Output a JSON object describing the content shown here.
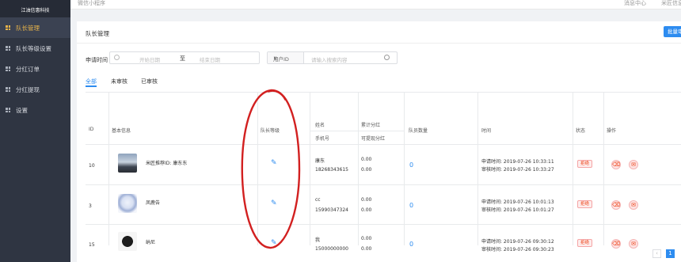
{
  "brand": "江油信惠科技",
  "sidebar": {
    "items": [
      {
        "label": "队长管理",
        "active": true
      },
      {
        "label": "队长等级设置",
        "active": false
      },
      {
        "label": "分红订单",
        "active": false
      },
      {
        "label": "分红提现",
        "active": false
      },
      {
        "label": "设置",
        "active": false
      }
    ]
  },
  "topbar": {
    "app": "微信小程序",
    "messages": "消息中心",
    "user": "米匠信息"
  },
  "page": {
    "title": "队长管理",
    "batch_button": "批量审核"
  },
  "filters": {
    "date_label": "申请时间",
    "start_placeholder": "开始日期",
    "range_sep": "至",
    "end_placeholder": "结束日期",
    "select_value": "用户ID",
    "search_placeholder": "请输入搜索内容"
  },
  "tabs": [
    {
      "label": "全部",
      "active": true
    },
    {
      "label": "未审核",
      "active": false
    },
    {
      "label": "已审核",
      "active": false
    }
  ],
  "table": {
    "headers": {
      "id": "ID",
      "basic": "基本信息",
      "level": "队长等级",
      "name": "姓名",
      "phone": "手机号",
      "total": "累计分红",
      "withdrawable": "可提现分红",
      "members": "队员数量",
      "time": "时间",
      "status": "状态",
      "action": "操作"
    },
    "rows": [
      {
        "id": "10",
        "nickname": "米匠推荐ID: 康东东",
        "name": "康东",
        "phone": "18268343615",
        "total": "0.00",
        "withdrawable": "0.00",
        "members": "0",
        "apply_time": "申请时间: 2019-07-26 10:33:11",
        "review_time": "审核时间: 2019-07-26 10:33:27",
        "status": "拒绝"
      },
      {
        "id": "3",
        "nickname": "凤鹿告",
        "name": "cc",
        "phone": "15990347324",
        "total": "0.00",
        "withdrawable": "0.00",
        "members": "0",
        "apply_time": "申请时间: 2019-07-26 10:01:13",
        "review_time": "审核时间: 2019-07-26 10:01:27",
        "status": "拒绝"
      },
      {
        "id": "15",
        "nickname": "纳尼",
        "name": "我",
        "phone": "15000000000",
        "total": "0.00",
        "withdrawable": "0.00",
        "members": "0",
        "apply_time": "申请时间: 2019-07-26 09:30:12",
        "review_time": "审核时间: 2019-07-26 09:30:23",
        "status": "拒绝"
      }
    ]
  },
  "pagination": {
    "prev_symbol": "‹",
    "current_page": "1"
  },
  "icons": {
    "edit": "pencil-icon",
    "delete": "trash-icon",
    "message": "message-icon"
  },
  "colors": {
    "accent": "#2d8cf0",
    "sidebar_bg": "#2f3542",
    "active_nav": "#e7b34a",
    "danger": "#ed4014",
    "annotation": "#d22020"
  }
}
